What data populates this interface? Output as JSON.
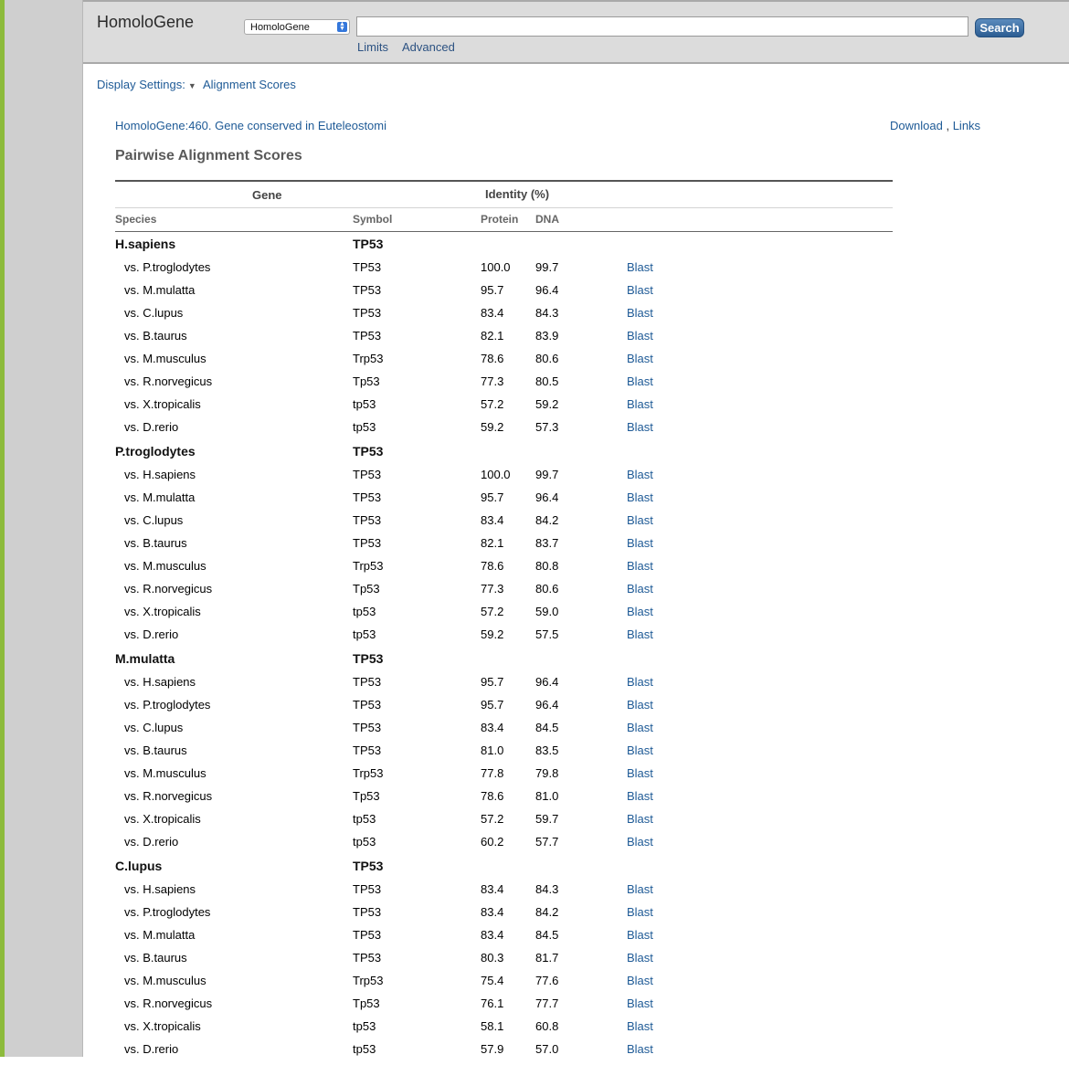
{
  "header": {
    "app_title": "HomoloGene",
    "db_select_value": "HomoloGene",
    "search_value": "",
    "search_button": "Search",
    "limits_link": "Limits",
    "advanced_link": "Advanced"
  },
  "toolbar": {
    "display_settings": "Display Settings:",
    "alignment_scores": "Alignment Scores"
  },
  "record": {
    "title": "HomoloGene:460. Gene conserved in Euteleostomi",
    "download": "Download",
    "sep": ",",
    "links": "Links"
  },
  "section_title": "Pairwise Alignment Scores",
  "table": {
    "col_gene": "Gene",
    "col_identity": "Identity (%)",
    "col_species": "Species",
    "col_symbol": "Symbol",
    "col_protein": "Protein",
    "col_dna": "DNA",
    "groups": [
      {
        "species": "H.sapiens",
        "symbol": "TP53",
        "rows": [
          {
            "vs": "vs. P.troglodytes",
            "symbol": "TP53",
            "protein": "100.0",
            "dna": "99.7",
            "blast": "Blast"
          },
          {
            "vs": "vs. M.mulatta",
            "symbol": "TP53",
            "protein": "95.7",
            "dna": "96.4",
            "blast": "Blast"
          },
          {
            "vs": "vs. C.lupus",
            "symbol": "TP53",
            "protein": "83.4",
            "dna": "84.3",
            "blast": "Blast"
          },
          {
            "vs": "vs. B.taurus",
            "symbol": "TP53",
            "protein": "82.1",
            "dna": "83.9",
            "blast": "Blast"
          },
          {
            "vs": "vs. M.musculus",
            "symbol": "Trp53",
            "protein": "78.6",
            "dna": "80.6",
            "blast": "Blast"
          },
          {
            "vs": "vs. R.norvegicus",
            "symbol": "Tp53",
            "protein": "77.3",
            "dna": "80.5",
            "blast": "Blast"
          },
          {
            "vs": "vs. X.tropicalis",
            "symbol": "tp53",
            "protein": "57.2",
            "dna": "59.2",
            "blast": "Blast"
          },
          {
            "vs": "vs. D.rerio",
            "symbol": "tp53",
            "protein": "59.2",
            "dna": "57.3",
            "blast": "Blast"
          }
        ]
      },
      {
        "species": "P.troglodytes",
        "symbol": "TP53",
        "rows": [
          {
            "vs": "vs. H.sapiens",
            "symbol": "TP53",
            "protein": "100.0",
            "dna": "99.7",
            "blast": "Blast"
          },
          {
            "vs": "vs. M.mulatta",
            "symbol": "TP53",
            "protein": "95.7",
            "dna": "96.4",
            "blast": "Blast"
          },
          {
            "vs": "vs. C.lupus",
            "symbol": "TP53",
            "protein": "83.4",
            "dna": "84.2",
            "blast": "Blast"
          },
          {
            "vs": "vs. B.taurus",
            "symbol": "TP53",
            "protein": "82.1",
            "dna": "83.7",
            "blast": "Blast"
          },
          {
            "vs": "vs. M.musculus",
            "symbol": "Trp53",
            "protein": "78.6",
            "dna": "80.8",
            "blast": "Blast"
          },
          {
            "vs": "vs. R.norvegicus",
            "symbol": "Tp53",
            "protein": "77.3",
            "dna": "80.6",
            "blast": "Blast"
          },
          {
            "vs": "vs. X.tropicalis",
            "symbol": "tp53",
            "protein": "57.2",
            "dna": "59.0",
            "blast": "Blast"
          },
          {
            "vs": "vs. D.rerio",
            "symbol": "tp53",
            "protein": "59.2",
            "dna": "57.5",
            "blast": "Blast"
          }
        ]
      },
      {
        "species": "M.mulatta",
        "symbol": "TP53",
        "rows": [
          {
            "vs": "vs. H.sapiens",
            "symbol": "TP53",
            "protein": "95.7",
            "dna": "96.4",
            "blast": "Blast"
          },
          {
            "vs": "vs. P.troglodytes",
            "symbol": "TP53",
            "protein": "95.7",
            "dna": "96.4",
            "blast": "Blast"
          },
          {
            "vs": "vs. C.lupus",
            "symbol": "TP53",
            "protein": "83.4",
            "dna": "84.5",
            "blast": "Blast"
          },
          {
            "vs": "vs. B.taurus",
            "symbol": "TP53",
            "protein": "81.0",
            "dna": "83.5",
            "blast": "Blast"
          },
          {
            "vs": "vs. M.musculus",
            "symbol": "Trp53",
            "protein": "77.8",
            "dna": "79.8",
            "blast": "Blast"
          },
          {
            "vs": "vs. R.norvegicus",
            "symbol": "Tp53",
            "protein": "78.6",
            "dna": "81.0",
            "blast": "Blast"
          },
          {
            "vs": "vs. X.tropicalis",
            "symbol": "tp53",
            "protein": "57.2",
            "dna": "59.7",
            "blast": "Blast"
          },
          {
            "vs": "vs. D.rerio",
            "symbol": "tp53",
            "protein": "60.2",
            "dna": "57.7",
            "blast": "Blast"
          }
        ]
      },
      {
        "species": "C.lupus",
        "symbol": "TP53",
        "rows": [
          {
            "vs": "vs. H.sapiens",
            "symbol": "TP53",
            "protein": "83.4",
            "dna": "84.3",
            "blast": "Blast"
          },
          {
            "vs": "vs. P.troglodytes",
            "symbol": "TP53",
            "protein": "83.4",
            "dna": "84.2",
            "blast": "Blast"
          },
          {
            "vs": "vs. M.mulatta",
            "symbol": "TP53",
            "protein": "83.4",
            "dna": "84.5",
            "blast": "Blast"
          },
          {
            "vs": "vs. B.taurus",
            "symbol": "TP53",
            "protein": "80.3",
            "dna": "81.7",
            "blast": "Blast"
          },
          {
            "vs": "vs. M.musculus",
            "symbol": "Trp53",
            "protein": "75.4",
            "dna": "77.6",
            "blast": "Blast"
          },
          {
            "vs": "vs. R.norvegicus",
            "symbol": "Tp53",
            "protein": "76.1",
            "dna": "77.7",
            "blast": "Blast"
          },
          {
            "vs": "vs. X.tropicalis",
            "symbol": "tp53",
            "protein": "58.1",
            "dna": "60.8",
            "blast": "Blast"
          },
          {
            "vs": "vs. D.rerio",
            "symbol": "tp53",
            "protein": "57.9",
            "dna": "57.0",
            "blast": "Blast"
          }
        ]
      }
    ]
  }
}
